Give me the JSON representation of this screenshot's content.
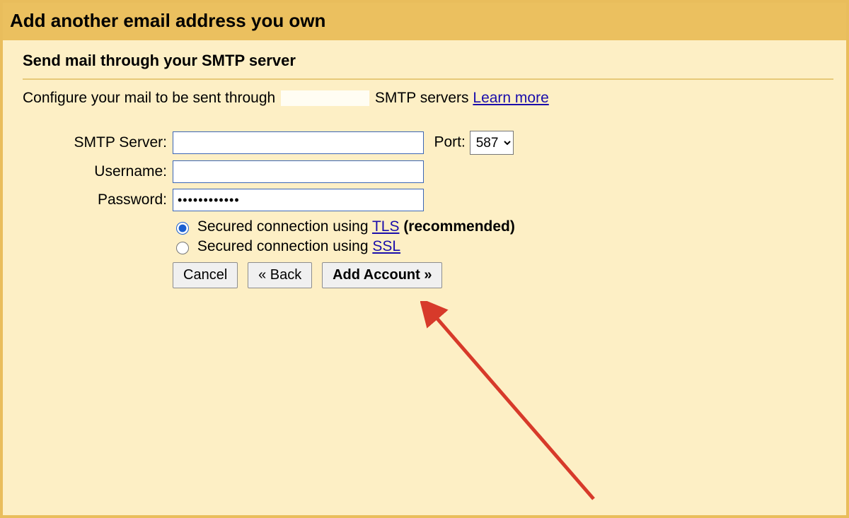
{
  "title": "Add another email address you own",
  "subtitle": "Send mail through your SMTP server",
  "intro_prefix": "Configure your mail to be sent through",
  "intro_suffix": "SMTP servers",
  "learn_more": "Learn more",
  "labels": {
    "smtp": "SMTP Server:",
    "port": "Port:",
    "user": "Username:",
    "pass": "Password:"
  },
  "values": {
    "smtp": "",
    "user": "",
    "pass": "••••••••••••",
    "port_selected": "587"
  },
  "radios": {
    "tls_prefix": "Secured connection using ",
    "tls_link": "TLS",
    "tls_suffix": " (recommended)",
    "ssl_prefix": "Secured connection using ",
    "ssl_link": "SSL"
  },
  "buttons": {
    "cancel": "Cancel",
    "back": "« Back",
    "add": "Add Account »"
  }
}
